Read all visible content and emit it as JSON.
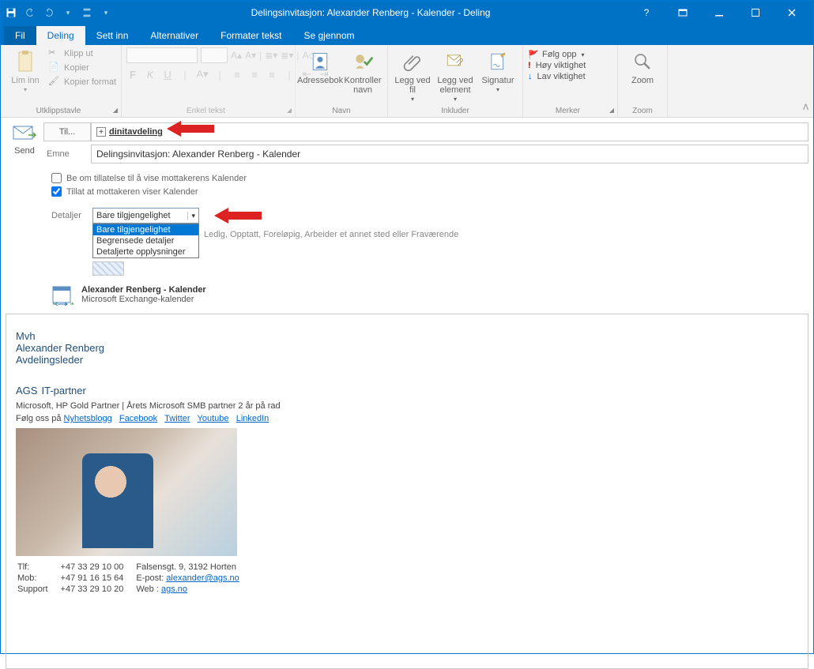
{
  "titlebar": {
    "title": "Delingsinvitasjon: Alexander Renberg - Kalender - Deling"
  },
  "tabs": {
    "fil": "Fil",
    "deling": "Deling",
    "settinn": "Sett inn",
    "alternativer": "Alternativer",
    "formater": "Formater tekst",
    "segjennom": "Se gjennom"
  },
  "ribbon": {
    "utklippstavle": {
      "label": "Utklippstavle",
      "lim_inn": "Lim inn",
      "klipp": "Klipp ut",
      "kopier": "Kopier",
      "kopier_format": "Kopier format"
    },
    "enkel_tekst": {
      "label": "Enkel tekst"
    },
    "navn": {
      "label": "Navn",
      "adressebok": "Adressebok",
      "kontroller_navn": "Kontroller navn"
    },
    "inkluder": {
      "label": "Inkluder",
      "legg_ved_fil": "Legg ved fil",
      "legg_ved_element": "Legg ved element",
      "signatur": "Signatur"
    },
    "merker": {
      "label": "Merker",
      "folg_opp": "Følg opp",
      "hoy": "Høy viktighet",
      "lav": "Lav viktighet"
    },
    "zoom": {
      "label": "Zoom",
      "btn": "Zoom"
    }
  },
  "composer": {
    "send": "Send",
    "til_btn": "Til...",
    "recipient": "dinitavdeling",
    "emne_label": "Emne",
    "emne_value": "Delingsinvitasjon: Alexander Renberg - Kalender",
    "opt1": "Be om tillatelse til å vise mottakerens Kalender",
    "opt2": "Tillat at mottakeren viser Kalender",
    "details_label": "Detaljer",
    "details_value": "Bare tilgjengelighet",
    "details_options": [
      "Bare tilgjengelighet",
      "Begrensede detaljer",
      "Detaljerte opplysninger"
    ],
    "details_hint": "Ledig, Opptatt, Foreløpig, Arbeider et annet sted eller Fraværende",
    "cal_name": "Alexander Renberg - Kalender",
    "cal_sub": "Microsoft Exchange-kalender"
  },
  "body": {
    "mvh": "Mvh",
    "name": "Alexander Renberg",
    "role": "Avdelingsleder",
    "company_main": "AGS",
    "company_sub": "IT-partner",
    "tagline": "Microsoft, HP Gold Partner | Årets Microsoft SMB partner 2 år på rad",
    "follow_prefix": "Følg oss på",
    "links": {
      "nyhetsblogg": "Nyhetsblogg",
      "facebook": "Facebook",
      "twitter": "Twitter",
      "youtube": "Youtube",
      "linkedin": "LinkedIn"
    },
    "contacts": {
      "tlf_label": "Tlf:",
      "tlf": "+47 33 29 10 00",
      "mob_label": "Mob:",
      "mob": "+47 91 16 15 64",
      "support_label": "Support",
      "support": "+47 33 29 10 20",
      "addr": "Falsensgt. 9, 3192  Horten",
      "epost_label": "E-post:",
      "epost": "alexander@ags.no",
      "web_label": "Web   :",
      "web": "ags.no"
    }
  }
}
